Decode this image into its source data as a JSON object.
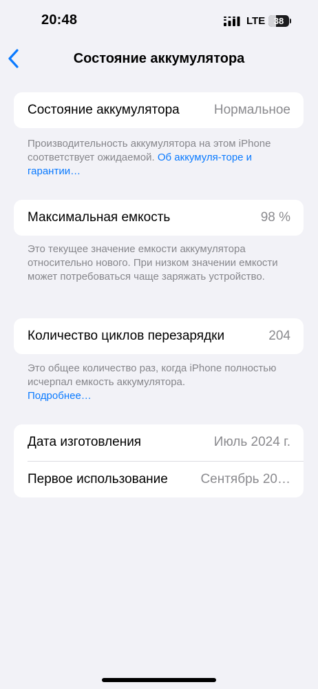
{
  "status_bar": {
    "time": "20:48",
    "network": "LTE",
    "battery": "38",
    "battery_level": 0.38
  },
  "nav": {
    "title": "Состояние аккумулятора",
    "back_icon": "chevron-left-icon"
  },
  "sections": {
    "health": {
      "label": "Состояние аккумулятора",
      "value": "Нормальное",
      "note": "Производительность аккумулятора на этом iPhone соответствует ожидаемой.",
      "link": "Об аккумуля-торе и гарантии…"
    },
    "capacity": {
      "label": "Максимальная емкость",
      "value": "98 %",
      "note": "Это текущее значение емкости аккумулятора относительно нового. При низком значении емкости может потребоваться чаще заряжать устройство."
    },
    "cycles": {
      "label": "Количество циклов перезарядки",
      "value": "204",
      "note": "Это общее количество раз, когда iPhone полностью исчерпал емкость аккумулятора.",
      "link": "Подробнее…"
    },
    "dates": {
      "manufacture_label": "Дата изготовления",
      "manufacture_value": "Июль 2024 г.",
      "first_use_label": "Первое использование",
      "first_use_value": "Сентябрь 20…"
    }
  },
  "colors": {
    "background": "#f2f2f7",
    "accent": "#0a7aff",
    "secondary_text": "#86868b"
  }
}
